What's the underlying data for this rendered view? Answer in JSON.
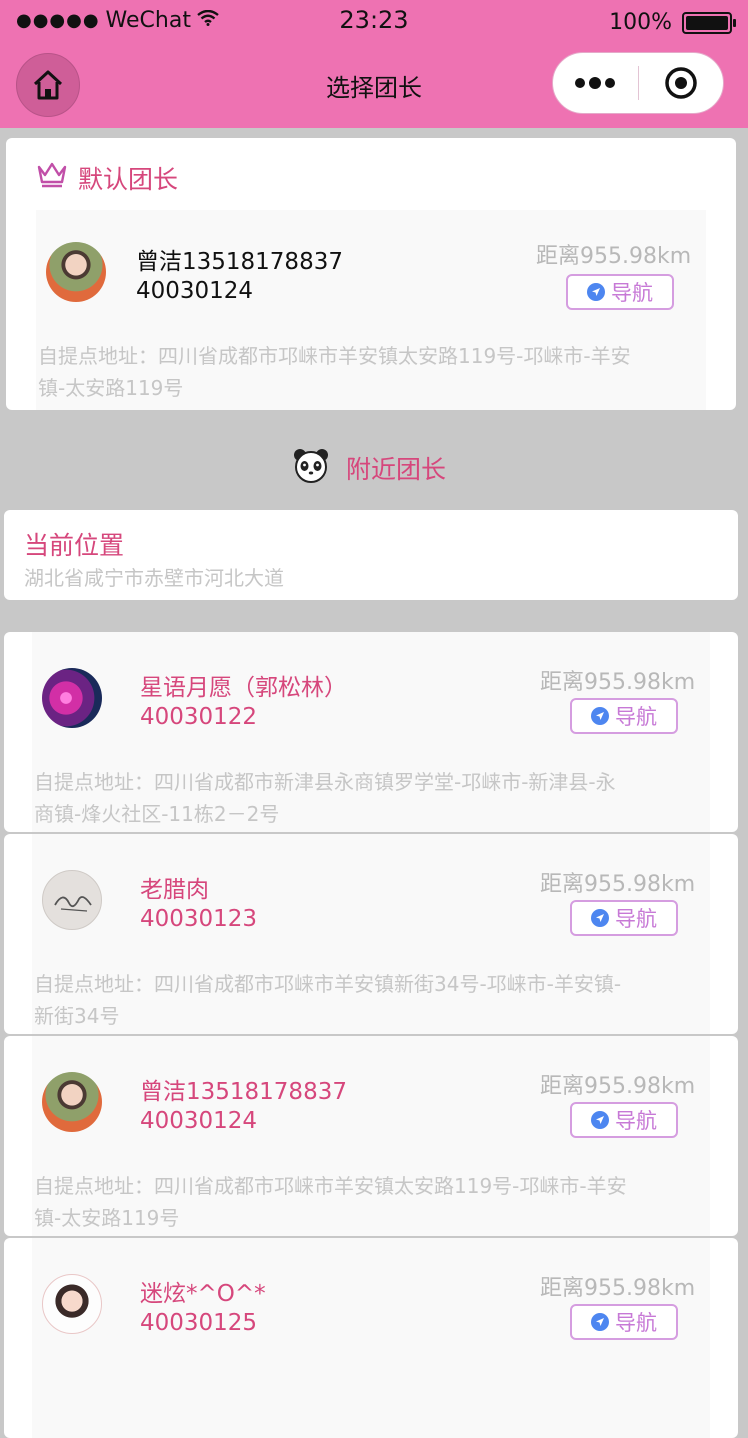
{
  "status_bar": {
    "signal": "●●●●●",
    "carrier": "WeChat",
    "time": "23:23",
    "battery": "100%"
  },
  "nav": {
    "title": "选择团长"
  },
  "default_section": {
    "title": "默认团长",
    "leader": {
      "name": "曾洁13518178837",
      "code": "40030124",
      "distance": "距离955.98km",
      "nav_label": "导航",
      "address": [
        "自提点地址：四川省成都市邛崃市羊安镇太安路119号-邛崃市-羊安",
        "镇-太安路119号"
      ]
    }
  },
  "nearby_section": {
    "title": "附近团长"
  },
  "current_location": {
    "title": "当前位置",
    "address": "湖北省咸宁市赤壁市河北大道"
  },
  "nearby_leaders": [
    {
      "name": "星语月愿（郭松林）",
      "code": "40030122",
      "distance": "距离955.98km",
      "nav_label": "导航",
      "address": [
        "自提点地址：四川省成都市新津县永商镇罗学堂-邛崃市-新津县-永",
        "商镇-烽火社区-11栋2－2号"
      ]
    },
    {
      "name": "老腊肉",
      "code": "40030123",
      "distance": "距离955.98km",
      "nav_label": "导航",
      "address": [
        "自提点地址：四川省成都市邛崃市羊安镇新街34号-邛崃市-羊安镇-",
        "新街34号"
      ]
    },
    {
      "name": "曾洁13518178837",
      "code": "40030124",
      "distance": "距离955.98km",
      "nav_label": "导航",
      "address": [
        "自提点地址：四川省成都市邛崃市羊安镇太安路119号-邛崃市-羊安",
        "镇-太安路119号"
      ]
    },
    {
      "name": "迷炫*^O^*",
      "code": "40030125",
      "distance": "距离955.98km",
      "nav_label": "导航",
      "address": [
        "",
        ""
      ]
    }
  ],
  "colors": {
    "header": "#ee72b2",
    "accent": "#d6477c",
    "nav_border": "#d59de0",
    "muted": "#c6c6c6"
  }
}
